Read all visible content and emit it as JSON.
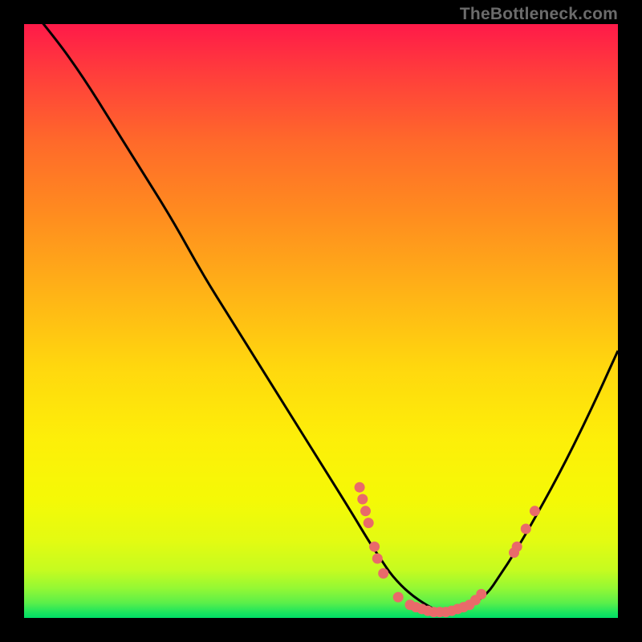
{
  "attribution": "TheBottleneck.com",
  "colors": {
    "marker": "#e96a6a",
    "curve": "#000000",
    "background_frame": "#000000"
  },
  "chart_data": {
    "type": "line",
    "title": "",
    "xlabel": "",
    "ylabel": "",
    "xlim": [
      0,
      100
    ],
    "ylim": [
      0,
      100
    ],
    "grid": false,
    "legend": false,
    "series": [
      {
        "name": "bottleneck-curve",
        "x": [
          0,
          5,
          10,
          15,
          20,
          25,
          30,
          35,
          40,
          45,
          50,
          55,
          58,
          60,
          62,
          65,
          68,
          70,
          72,
          75,
          78,
          80,
          82,
          85,
          90,
          95,
          100
        ],
        "y": [
          104,
          98,
          91,
          83,
          75,
          67,
          58,
          50,
          42,
          34,
          26,
          18,
          13,
          10,
          7,
          4,
          2,
          1,
          1,
          2,
          4,
          7,
          10,
          15,
          24,
          34,
          45
        ]
      }
    ],
    "markers": [
      {
        "x": 56.5,
        "y": 22
      },
      {
        "x": 57.0,
        "y": 20
      },
      {
        "x": 57.5,
        "y": 18
      },
      {
        "x": 58.0,
        "y": 16
      },
      {
        "x": 59.0,
        "y": 12
      },
      {
        "x": 59.5,
        "y": 10
      },
      {
        "x": 60.5,
        "y": 7.5
      },
      {
        "x": 63.0,
        "y": 3.5
      },
      {
        "x": 65.0,
        "y": 2.2
      },
      {
        "x": 66.0,
        "y": 1.8
      },
      {
        "x": 67.0,
        "y": 1.5
      },
      {
        "x": 68.0,
        "y": 1.2
      },
      {
        "x": 69.0,
        "y": 1.0
      },
      {
        "x": 70.0,
        "y": 1.0
      },
      {
        "x": 71.0,
        "y": 1.0
      },
      {
        "x": 72.0,
        "y": 1.2
      },
      {
        "x": 73.0,
        "y": 1.5
      },
      {
        "x": 74.0,
        "y": 1.8
      },
      {
        "x": 75.0,
        "y": 2.2
      },
      {
        "x": 76.0,
        "y": 3.0
      },
      {
        "x": 77.0,
        "y": 4.0
      },
      {
        "x": 82.5,
        "y": 11
      },
      {
        "x": 83.0,
        "y": 12
      },
      {
        "x": 84.5,
        "y": 15
      },
      {
        "x": 86.0,
        "y": 18
      }
    ]
  }
}
